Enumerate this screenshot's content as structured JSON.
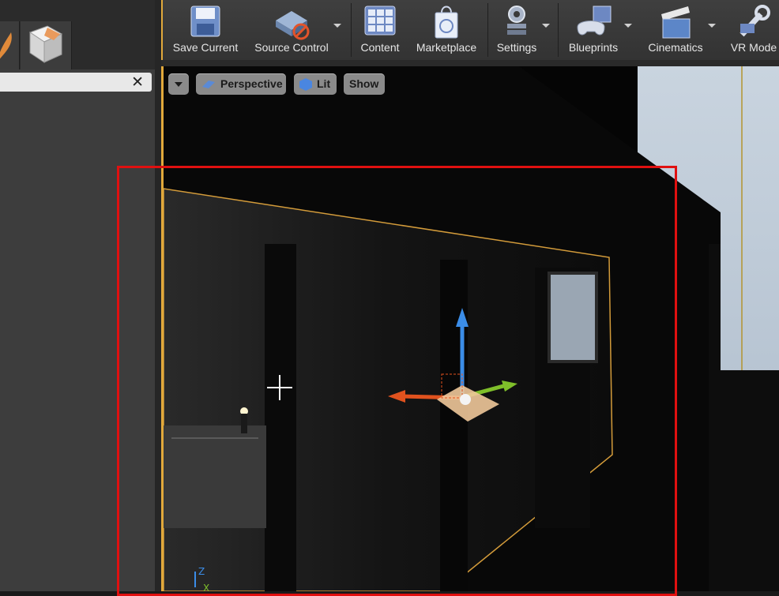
{
  "left_panel": {
    "search": {
      "value": "",
      "clear_glyph": "✕"
    }
  },
  "toolbar": {
    "buttons": [
      {
        "label": "Save Current",
        "icon": "floppy-disk-icon"
      },
      {
        "label": "Source Control",
        "icon": "source-control-icon",
        "has_dropdown": true
      },
      {
        "label": "Content",
        "icon": "content-grid-icon"
      },
      {
        "label": "Marketplace",
        "icon": "shopping-bag-icon"
      },
      {
        "label": "Settings",
        "icon": "gear-icon",
        "has_dropdown": true
      },
      {
        "label": "Blueprints",
        "icon": "gamepad-icon",
        "has_dropdown": true
      },
      {
        "label": "Cinematics",
        "icon": "clapperboard-icon",
        "has_dropdown": true
      },
      {
        "label": "VR Mode",
        "icon": "vr-wrench-icon"
      }
    ]
  },
  "viewport": {
    "view_mode": "Perspective",
    "lighting": "Lit",
    "show": "Show",
    "axis": {
      "z": "Z",
      "x": "X"
    }
  },
  "colors": {
    "selection_outline": "#e01010",
    "accent_border": "#e2a93b",
    "gizmo_x": "#e0521e",
    "gizmo_y": "#7fbf2a",
    "gizmo_z": "#3b8de8"
  }
}
